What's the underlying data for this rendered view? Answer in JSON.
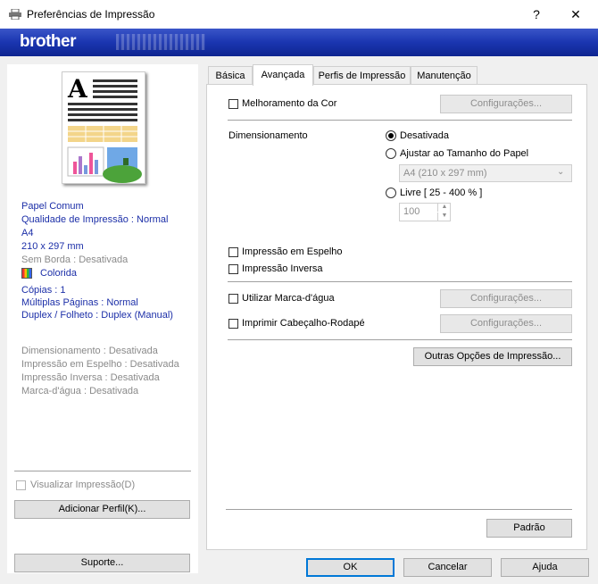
{
  "window": {
    "title": "Preferências de Impressão",
    "help": "?",
    "close": "✕"
  },
  "brand": "brother",
  "preview_summary": {
    "lines_blue": [
      "Papel Comum",
      "Qualidade de Impressão : Normal",
      "A4",
      "210 x 297 mm"
    ],
    "borderless": "Sem Borda : Desativada",
    "color": "Colorida",
    "lines_blue2": [
      "Cópias : 1",
      "Múltiplas Páginas : Normal",
      "Duplex / Folheto : Duplex (Manual)"
    ],
    "lines_gray": [
      "Dimensionamento : Desativada",
      "Impressão em Espelho : Desativada",
      "Impressão Inversa : Desativada",
      "Marca-d'água : Desativada"
    ]
  },
  "left_controls": {
    "preview_checkbox": "Visualizar Impressão(D)",
    "add_profile": "Adicionar Perfil(K)...",
    "support": "Suporte..."
  },
  "tabs": [
    "Básica",
    "Avançada",
    "Perfis de Impressão",
    "Manutenção"
  ],
  "advanced": {
    "color_enhance": "Melhoramento da Cor",
    "settings": "Configurações...",
    "scaling_label": "Dimensionamento",
    "scaling_off": "Desativada",
    "fit_paper": "Ajustar ao Tamanho do Papel",
    "paper_size": "A4 (210 x 297 mm)",
    "free": "Livre [ 25 - 400 % ]",
    "free_value": "100",
    "mirror": "Impressão em Espelho",
    "reverse": "Impressão Inversa",
    "watermark": "Utilizar Marca-d'água",
    "header_footer": "Imprimir Cabeçalho-Rodapé",
    "other_options": "Outras Opções de Impressão...",
    "default": "Padrão"
  },
  "footer": {
    "ok": "OK",
    "cancel": "Cancelar",
    "help": "Ajuda"
  }
}
